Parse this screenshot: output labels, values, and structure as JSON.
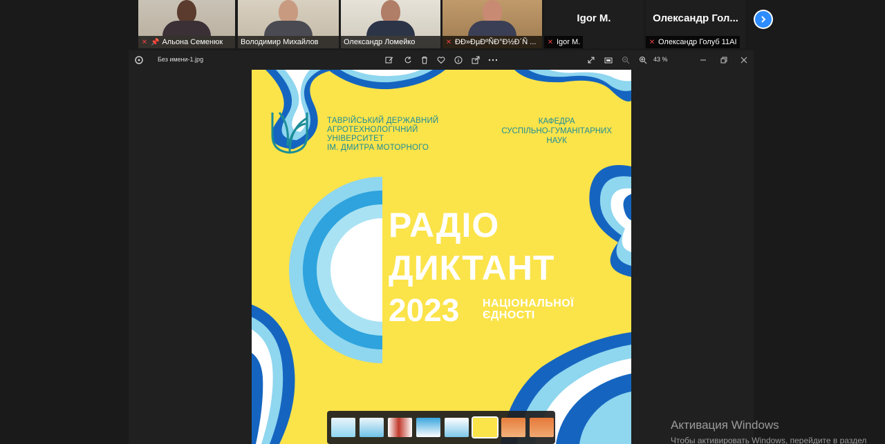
{
  "participants": [
    {
      "name": "Альона Семенюк",
      "muted": true,
      "pinned": true
    },
    {
      "name": "Володимир Михайлов",
      "muted": false,
      "active": true
    },
    {
      "name": "Олександр Ломейко",
      "muted": false
    },
    {
      "name": "ÐÐ»ÐµÐºÑÐ°Ð½Ð´Ñ ...",
      "muted": true
    },
    {
      "name": "Igor M.",
      "display_name": "Igor M.",
      "muted": true
    },
    {
      "name": "Олександр Голуб 11AI",
      "display_name": "Олександр  Гол...",
      "muted": true
    }
  ],
  "viewer": {
    "filename": "Без имени-1.jpg",
    "zoom": "43 %"
  },
  "poster": {
    "university": [
      "ТАВРІЙСЬКИЙ ДЕРЖАВНИЙ",
      "АГРОТЕХНОЛОГІЧНИЙ",
      "УНІВЕРСИТЕТ",
      "ІМ. ДМИТРА МОТОРНОГО"
    ],
    "department": [
      "КАФЕДРА",
      "СУСПІЛЬНО-ГУМАНІТАРНИХ",
      "НАУК"
    ],
    "title_line1": "РАДІО",
    "title_line2": "ДИКТАНТ",
    "year": "2023",
    "subtitle": [
      "НАЦІОНАЛЬНОЇ",
      "ЄДНОСТІ"
    ]
  },
  "activation": {
    "title": "Активация Windows",
    "hint": "Чтобы активировать Windows, перейдите в раздел"
  },
  "colors": {
    "poster_bg": "#fbe34a",
    "accent_teal": "#1c8d97",
    "wave_blue": "#1565c0",
    "wave_light": "#8fd6ef",
    "zoom_blue": "#2d8cff"
  }
}
